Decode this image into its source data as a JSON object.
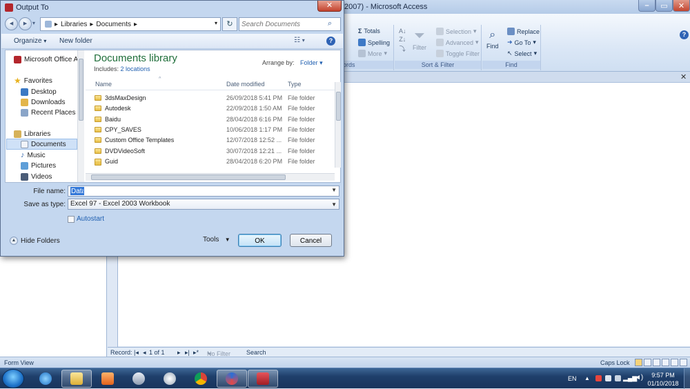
{
  "access": {
    "title": "2007) - Microsoft Access",
    "ribbon": {
      "records": {
        "totals": "Totals",
        "spelling": "Spelling",
        "more": "More",
        "label_partial": "ords"
      },
      "sort_filter": {
        "filter": "Filter",
        "selection": "Selection",
        "advanced": "Advanced",
        "toggle": "Toggle Filter",
        "label": "Sort & Filter"
      },
      "find": {
        "find": "Find",
        "replace": "Replace",
        "goto": "Go To",
        "select": "Select",
        "label": "Find"
      }
    },
    "record_bar": {
      "label": "Record:",
      "position": "1 of 1",
      "filter": "No Filter",
      "search": "Search"
    },
    "status": {
      "view": "Form View",
      "caps": "Caps Lock"
    }
  },
  "dialog": {
    "title": "Output To",
    "breadcrumb": [
      "Libraries",
      "Documents"
    ],
    "search_placeholder": "Search Documents",
    "toolbar": {
      "organize": "Organize",
      "new_folder": "New folder"
    },
    "sidebar": [
      {
        "label": "Microsoft Office Ac",
        "icon": "access-icon"
      },
      {
        "label": "Favorites",
        "icon": "star-icon"
      },
      {
        "label": "Desktop",
        "icon": "desktop-icon"
      },
      {
        "label": "Downloads",
        "icon": "downloads-icon"
      },
      {
        "label": "Recent Places",
        "icon": "recent-icon"
      },
      {
        "label": "Libraries",
        "icon": "libraries-icon"
      },
      {
        "label": "Documents",
        "icon": "documents-icon",
        "selected": true
      },
      {
        "label": "Music",
        "icon": "music-icon"
      },
      {
        "label": "Pictures",
        "icon": "pictures-icon"
      },
      {
        "label": "Videos",
        "icon": "videos-icon"
      }
    ],
    "library": {
      "title": "Documents library",
      "includes_prefix": "Includes:",
      "includes_link": "2 locations",
      "arrange_label": "Arrange by:",
      "arrange_value": "Folder"
    },
    "columns": {
      "name": "Name",
      "date": "Date modified",
      "type": "Type"
    },
    "files": [
      {
        "name": "3dsMaxDesign",
        "date": "26/09/2018 5:41 PM",
        "type": "File folder"
      },
      {
        "name": "Autodesk",
        "date": "22/09/2018 1:50 AM",
        "type": "File folder"
      },
      {
        "name": "Baidu",
        "date": "28/04/2018 6:16 PM",
        "type": "File folder"
      },
      {
        "name": "CPY_SAVES",
        "date": "10/06/2018 1:17 PM",
        "type": "File folder"
      },
      {
        "name": "Custom Office Templates",
        "date": "12/07/2018 12:52 ...",
        "type": "File folder"
      },
      {
        "name": "DVDVideoSoft",
        "date": "30/07/2018 12:21 ...",
        "type": "File folder"
      },
      {
        "name": "Guid",
        "date": "28/04/2018 6:20 PM",
        "type": "File folder"
      }
    ],
    "file_name_label": "File name:",
    "file_name_value": "Data",
    "save_type_label": "Save as type:",
    "save_type_value": "Excel 97 - Excel 2003 Workbook",
    "autostart": "Autostart",
    "hide_folders": "Hide Folders",
    "tools": "Tools",
    "ok": "OK",
    "cancel": "Cancel"
  },
  "taskbar": {
    "lang": "EN",
    "time": "9:57 PM",
    "date": "01/10/2018",
    "apps": [
      "internet-explorer",
      "file-explorer",
      "media-player",
      "snipping-tool",
      "system-tool",
      "chrome",
      "app-swirl",
      "access"
    ]
  },
  "colors": {
    "library_title": "#1f6e3a",
    "link": "#1f5fb0",
    "selection": "#3277d8",
    "taskbar": "#1f3f6b"
  }
}
